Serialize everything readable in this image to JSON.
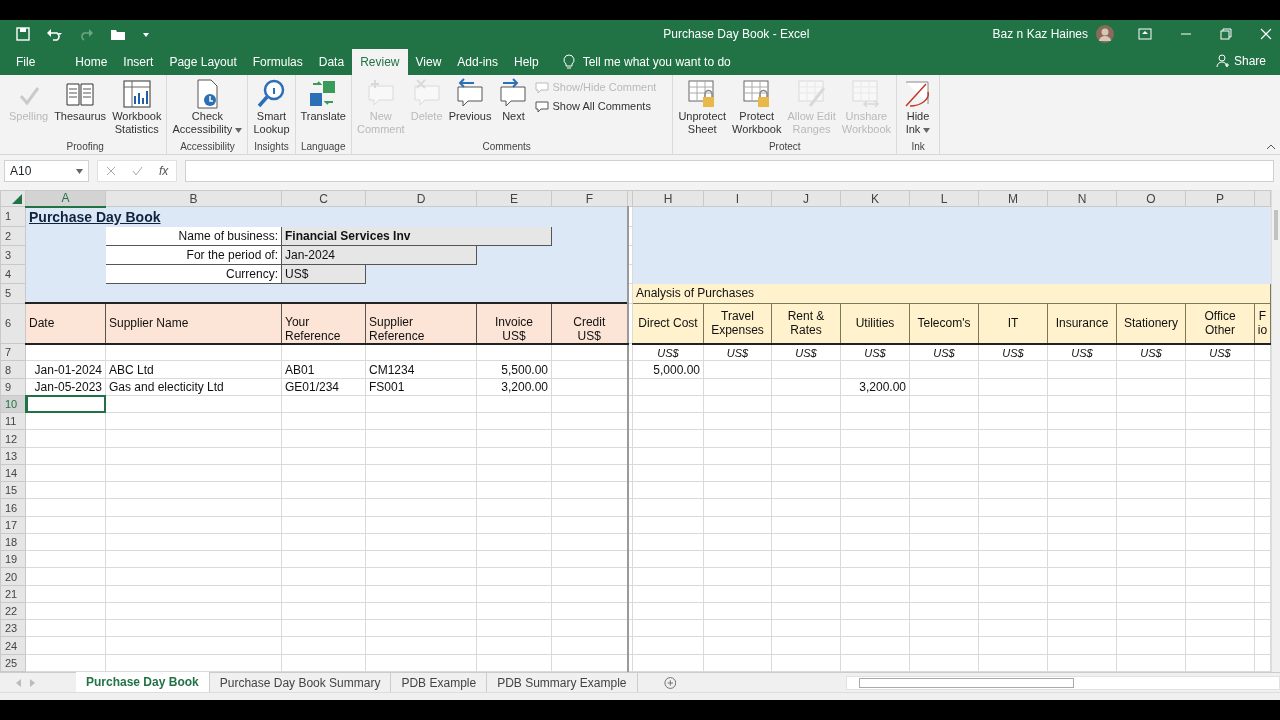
{
  "window": {
    "title": "Purchase Day Book  -  Excel",
    "user": "Baz n Kaz Haines"
  },
  "menu_tabs": [
    {
      "label": "File",
      "selected": false
    },
    {
      "label": "Home",
      "selected": false
    },
    {
      "label": "Insert",
      "selected": false
    },
    {
      "label": "Page Layout",
      "selected": false
    },
    {
      "label": "Formulas",
      "selected": false
    },
    {
      "label": "Data",
      "selected": false
    },
    {
      "label": "Review",
      "selected": true
    },
    {
      "label": "View",
      "selected": false
    },
    {
      "label": "Add-ins",
      "selected": false
    },
    {
      "label": "Help",
      "selected": false
    }
  ],
  "tell_me": {
    "placeholder": "Tell me what you want to do"
  },
  "share": "Share",
  "ribbon": [
    {
      "label": "Proofing",
      "buttons": [
        {
          "kind": "large",
          "label_lines": [
            "Spelling"
          ],
          "disabled": true
        },
        {
          "kind": "large",
          "label_lines": [
            "Thesaurus"
          ],
          "disabled": false
        },
        {
          "kind": "large",
          "label_lines": [
            "Workbook",
            "Statistics"
          ],
          "disabled": false
        }
      ]
    },
    {
      "label": "Accessibility",
      "buttons": [
        {
          "kind": "large",
          "label_lines": [
            "Check",
            "Accessibility"
          ],
          "disabled": false,
          "dropdown": true
        }
      ]
    },
    {
      "label": "Insights",
      "buttons": [
        {
          "kind": "large",
          "label_lines": [
            "Smart",
            "Lookup"
          ],
          "disabled": false
        }
      ]
    },
    {
      "label": "Language",
      "buttons": [
        {
          "kind": "large",
          "label_lines": [
            "Translate"
          ],
          "disabled": false
        }
      ]
    },
    {
      "label": "Comments",
      "buttons": [
        {
          "kind": "large",
          "label_lines": [
            "New",
            "Comment"
          ],
          "disabled": true
        },
        {
          "kind": "large",
          "label_lines": [
            "Delete"
          ],
          "disabled": true
        },
        {
          "kind": "large",
          "label_lines": [
            "Previous"
          ],
          "disabled": false
        },
        {
          "kind": "large",
          "label_lines": [
            "Next"
          ],
          "disabled": false
        },
        {
          "kind": "small",
          "label_lines": [
            "Show/Hide Comment"
          ],
          "disabled": true
        },
        {
          "kind": "small",
          "label_lines": [
            "Show All Comments"
          ],
          "disabled": false
        }
      ]
    },
    {
      "label": "Protect",
      "buttons": [
        {
          "kind": "large",
          "label_lines": [
            "Unprotect",
            "Sheet"
          ],
          "disabled": false
        },
        {
          "kind": "large",
          "label_lines": [
            "Protect",
            "Workbook"
          ],
          "disabled": false
        },
        {
          "kind": "large",
          "label_lines": [
            "Allow Edit",
            "Ranges"
          ],
          "disabled": true
        },
        {
          "kind": "large",
          "label_lines": [
            "Unshare",
            "Workbook"
          ],
          "disabled": true
        }
      ]
    },
    {
      "label": "Ink",
      "buttons": [
        {
          "kind": "large",
          "label_lines": [
            "Hide",
            "Ink"
          ],
          "disabled": false,
          "dropdown": true
        }
      ]
    }
  ],
  "formula_bar": {
    "name_box": "A10",
    "function_label": "fx"
  },
  "sheet": {
    "column_headers": [
      {
        "letter": "A",
        "selected": true
      },
      {
        "letter": "B",
        "selected": false
      },
      {
        "letter": "C",
        "selected": false
      },
      {
        "letter": "D",
        "selected": false
      },
      {
        "letter": "E",
        "selected": false
      },
      {
        "letter": "F",
        "selected": false
      },
      {
        "letter": "H",
        "selected": false
      },
      {
        "letter": "I",
        "selected": false
      },
      {
        "letter": "J",
        "selected": false
      },
      {
        "letter": "K",
        "selected": false
      },
      {
        "letter": "L",
        "selected": false
      },
      {
        "letter": "M",
        "selected": false
      },
      {
        "letter": "N",
        "selected": false
      },
      {
        "letter": "O",
        "selected": false
      },
      {
        "letter": "P",
        "selected": false
      }
    ],
    "row_headers": [
      {
        "label": "1",
        "selected": false
      },
      {
        "label": "2",
        "selected": false
      },
      {
        "label": "3",
        "selected": false
      },
      {
        "label": "4",
        "selected": false
      },
      {
        "label": "5",
        "selected": false
      },
      {
        "label": "6",
        "selected": false
      },
      {
        "label": "7",
        "selected": false
      },
      {
        "label": "8",
        "selected": false
      },
      {
        "label": "9",
        "selected": false
      },
      {
        "label": "10",
        "selected": true
      },
      {
        "label": "11",
        "selected": false
      },
      {
        "label": "12",
        "selected": false
      },
      {
        "label": "13",
        "selected": false
      },
      {
        "label": "14",
        "selected": false
      },
      {
        "label": "15",
        "selected": false
      },
      {
        "label": "16",
        "selected": false
      },
      {
        "label": "17",
        "selected": false
      },
      {
        "label": "18",
        "selected": false
      },
      {
        "label": "19",
        "selected": false
      },
      {
        "label": "20",
        "selected": false
      },
      {
        "label": "21",
        "selected": false
      },
      {
        "label": "22",
        "selected": false
      },
      {
        "label": "23",
        "selected": false
      },
      {
        "label": "24",
        "selected": false
      },
      {
        "label": "25",
        "selected": false
      }
    ],
    "title": "Purchase Day Book",
    "info": [
      {
        "label": "Name of business:",
        "value": "Financial Services Inv"
      },
      {
        "label": "For the period of:",
        "value": "Jan-2024"
      },
      {
        "label": "Currency:",
        "value": "US$"
      }
    ],
    "columns": [
      {
        "lines": [
          "Date"
        ],
        "kind": "text"
      },
      {
        "lines": [
          "Supplier Name"
        ],
        "kind": "text"
      },
      {
        "lines": [
          "Your",
          "Reference"
        ],
        "kind": "text"
      },
      {
        "lines": [
          "Supplier",
          "Reference"
        ],
        "kind": "text"
      },
      {
        "lines": [
          "Invoice",
          "US$"
        ],
        "kind": "amount"
      },
      {
        "lines": [
          "Credit",
          "US$"
        ],
        "kind": "amount"
      }
    ],
    "analysis": {
      "title": "Analysis of Purchases",
      "columns": [
        {
          "lines": [
            "Direct Cost"
          ],
          "currency": "US$"
        },
        {
          "lines": [
            "Travel",
            "Expenses"
          ],
          "currency": "US$"
        },
        {
          "lines": [
            "Rent &",
            "Rates"
          ],
          "currency": "US$"
        },
        {
          "lines": [
            "Utilities"
          ],
          "currency": "US$"
        },
        {
          "lines": [
            "Telecom's"
          ],
          "currency": "US$"
        },
        {
          "lines": [
            "IT"
          ],
          "currency": "US$"
        },
        {
          "lines": [
            "Insurance"
          ],
          "currency": "US$"
        },
        {
          "lines": [
            "Stationery"
          ],
          "currency": "US$"
        },
        {
          "lines": [
            "Office",
            "Other"
          ],
          "currency": "US$"
        }
      ],
      "partial_column": {
        "lines": [
          "F",
          "io"
        ]
      }
    },
    "entries": [
      {
        "date": "Jan-01-2024",
        "supplier": "ABC Ltd",
        "your_reference": "AB01",
        "supplier_reference": "CM1234",
        "invoice": "5,500.00",
        "analysis": [
          {
            "kind": "amount",
            "value": "5,000.00"
          },
          {
            "kind": "blank"
          },
          {
            "kind": "blank"
          },
          {
            "kind": "blank"
          },
          {
            "kind": "blank"
          },
          {
            "kind": "blank"
          },
          {
            "kind": "blank"
          },
          {
            "kind": "blank"
          },
          {
            "kind": "blank"
          }
        ]
      },
      {
        "date": "Jan-05-2023",
        "supplier": "Gas and electicity Ltd",
        "your_reference": "GE01/234",
        "supplier_reference": "FS001",
        "invoice": "3,200.00",
        "analysis": [
          {
            "kind": "blank"
          },
          {
            "kind": "blank"
          },
          {
            "kind": "blank"
          },
          {
            "kind": "amount",
            "value": "3,200.00"
          },
          {
            "kind": "blank"
          },
          {
            "kind": "blank"
          },
          {
            "kind": "blank"
          },
          {
            "kind": "blank"
          },
          {
            "kind": "blank"
          }
        ]
      }
    ]
  },
  "sheet_tabs": [
    {
      "label": "Purchase Day Book",
      "selected": true
    },
    {
      "label": "Purchase Day Book Summary",
      "selected": false
    },
    {
      "label": "PDB Example",
      "selected": false
    },
    {
      "label": "PDB Summary Example",
      "selected": false
    }
  ]
}
